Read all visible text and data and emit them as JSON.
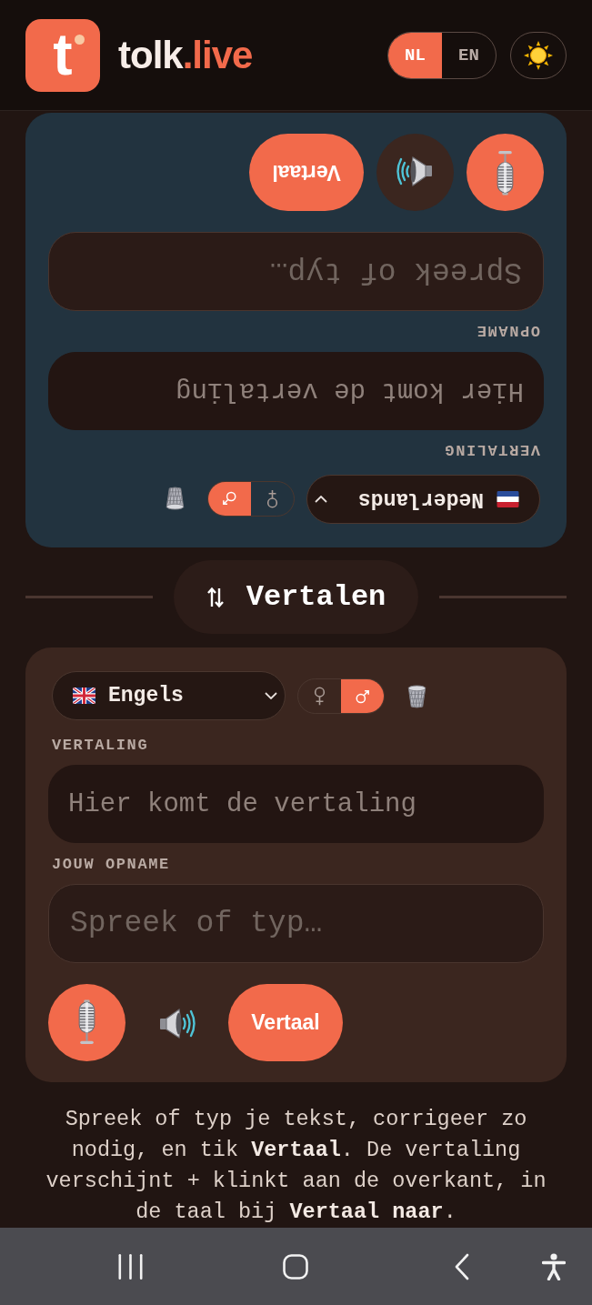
{
  "header": {
    "logo": {
      "mark": "t",
      "name": "tolk",
      "accent": ".live"
    },
    "languages": [
      {
        "label": "NL",
        "selected": true
      },
      {
        "label": "EN",
        "selected": false
      }
    ]
  },
  "top_panel": {
    "kind": "partner",
    "flipped": true,
    "language": {
      "kind": "nl",
      "value": "Nederlands"
    },
    "voices": [
      {
        "kind": "female",
        "selected": false
      },
      {
        "kind": "male",
        "selected": true
      }
    ],
    "translation": {
      "label": "VERTALING",
      "placeholder": "Hier komt de vertaling"
    },
    "recording": {
      "label": "OPNAME",
      "placeholder": "Spreek of typ…"
    },
    "translate_button": "Vertaal"
  },
  "swap_button": "Vertalen",
  "bottom_panel": {
    "kind": "self",
    "flipped": false,
    "language": {
      "kind": "gb",
      "value": "Engels"
    },
    "voices": [
      {
        "kind": "female",
        "selected": false
      },
      {
        "kind": "male",
        "selected": true
      }
    ],
    "translation": {
      "label": "VERTALING",
      "placeholder": "Hier komt de vertaling"
    },
    "recording": {
      "label": "JOUW OPNAME",
      "placeholder": "Spreek of typ…"
    },
    "translate_button": "Vertaal"
  },
  "hint": "Spreek of typ je tekst, corrigeer zo nodig, en tik **Vertaal**. De vertaling verschijnt + klinkt aan de overkant, in de taal bij **Vertaal naar**."
}
